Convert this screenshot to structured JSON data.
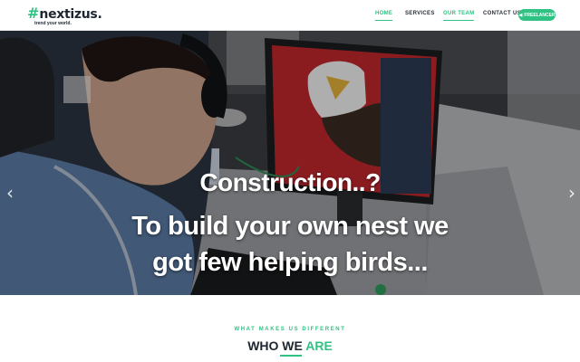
{
  "brand": {
    "mark": "#",
    "name": "nextizus.",
    "tagline": "trend your world."
  },
  "nav": {
    "items": [
      {
        "label": "HOME"
      },
      {
        "label": "SERVICES"
      },
      {
        "label": "OUR TEAM"
      },
      {
        "label": "CONTACT US"
      }
    ],
    "cta_label": "FREELANCER",
    "cta_icon": "megaphone-icon"
  },
  "hero": {
    "line1": "Construction..?",
    "line2": "To build your own nest we",
    "line3": "got few helping birds...",
    "prev_glyph": "‹",
    "next_glyph": "›"
  },
  "section": {
    "eyebrow": "WHAT MAKES US DIFFERENT",
    "title_main": "WHO WE ",
    "title_accent": "ARE"
  },
  "colors": {
    "accent": "#2fc283",
    "dark": "#1d2630"
  }
}
